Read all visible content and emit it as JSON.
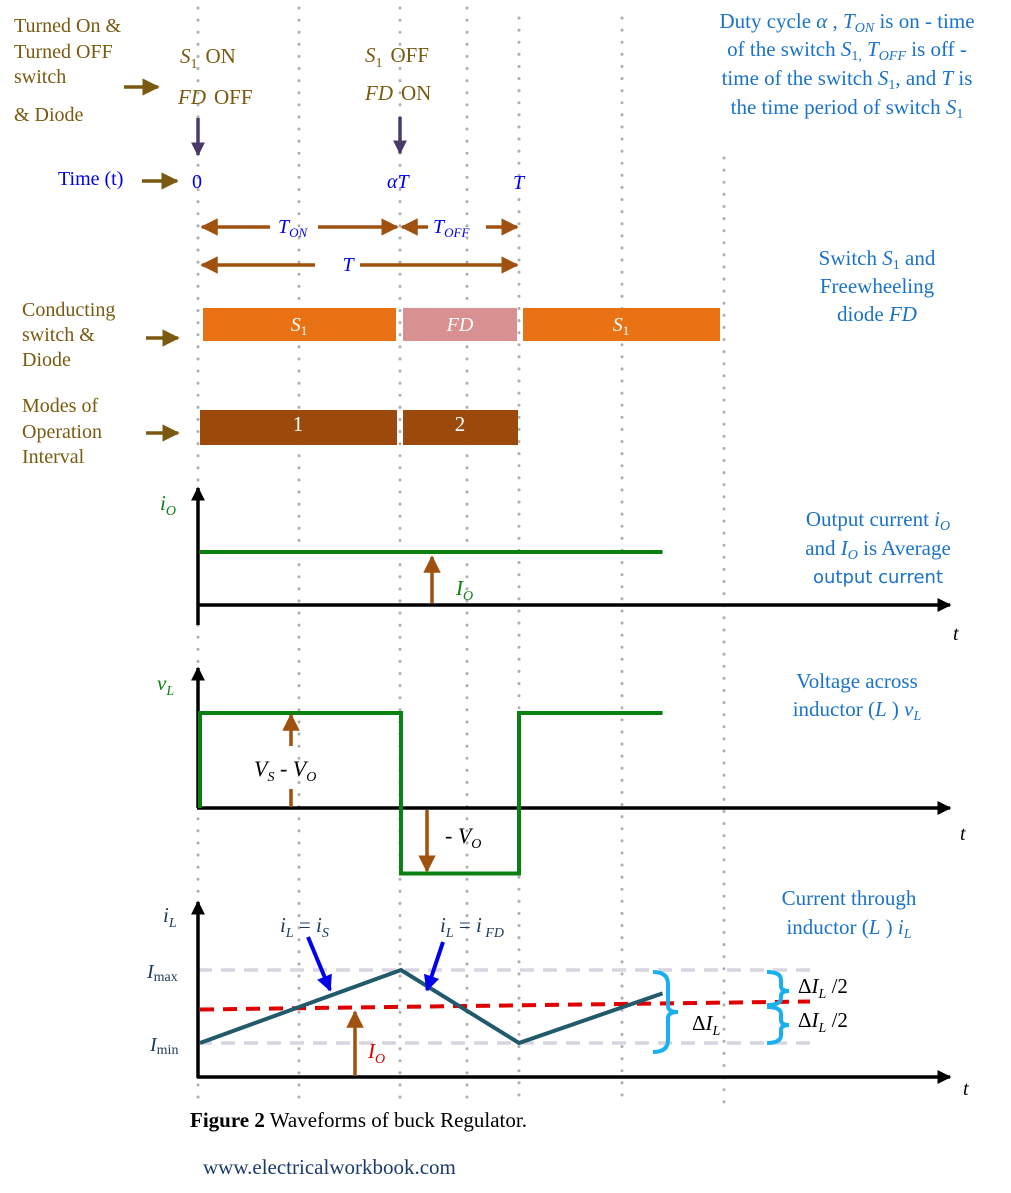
{
  "header": {
    "left_label_lines": [
      "Turned On &",
      "Turned OFF",
      "switch",
      "& Diode"
    ],
    "event_0": {
      "line1_sym": "S",
      "line1_sub": "1",
      "line1_state": "ON",
      "line2_sym": "FD",
      "line2_state": "OFF"
    },
    "event_aT": {
      "line1_sym": "S",
      "line1_sub": "1",
      "line1_state": "OFF",
      "line2_sym": "FD",
      "line2_state": "ON"
    },
    "time_label": "Time (t)",
    "time_ticks": [
      "0",
      "αT",
      "T"
    ]
  },
  "description": {
    "lines": [
      "Duty cycle α , T_ON is on - time",
      "of the switch S1, T_OFF is off -",
      "time of the switch S1, and T is",
      "the time period of switch S1"
    ]
  },
  "intervals": {
    "ton": "T",
    "ton_sub": "ON",
    "toff": "T",
    "toff_sub": "OFF",
    "period": "T"
  },
  "conducting": {
    "label_lines": [
      "Conducting",
      "switch &",
      "Diode"
    ],
    "segments": [
      {
        "label": "S",
        "sub": "1",
        "color": "#e87214"
      },
      {
        "label": "FD",
        "sub": "",
        "color": "#d89090"
      },
      {
        "label": "S",
        "sub": "1",
        "color": "#e87214"
      }
    ],
    "note_lines": [
      "Switch S1 and",
      "Freewheeling",
      "diode FD"
    ]
  },
  "modes": {
    "label_lines": [
      "Modes of",
      "Operation",
      "Interval"
    ],
    "segments": [
      {
        "label": "1",
        "color": "#9b4a0c"
      },
      {
        "label": "2",
        "color": "#9b4a0c"
      }
    ]
  },
  "chart_data": [
    {
      "type": "line",
      "title": "Output current",
      "ylabel": "iO",
      "xlabel": "t",
      "series": [
        {
          "name": "iO",
          "x": [
            0,
            1.45
          ],
          "y": [
            1,
            1
          ],
          "color": "#0a8010"
        }
      ],
      "annotations": [
        {
          "text": "IO",
          "meaning": "Average output current"
        }
      ],
      "note_lines": [
        "Output current iO",
        "and IO is Average",
        "output current"
      ]
    },
    {
      "type": "line",
      "title": "Voltage across inductor",
      "ylabel": "vL",
      "xlabel": "t",
      "alpha": 0.63,
      "series": [
        {
          "name": "vL",
          "x": [
            0,
            0,
            0.63,
            0.63,
            1.0,
            1.0,
            1.45
          ],
          "y": [
            0,
            1,
            1,
            -0.69,
            -0.69,
            1,
            1
          ],
          "color": "#0a8010"
        }
      ],
      "annotations": [
        {
          "text": "VS - VO",
          "level": "positive"
        },
        {
          "text": "- VO",
          "level": "negative"
        }
      ],
      "note_lines": [
        "Voltage across",
        "inductor (L) vL"
      ]
    },
    {
      "type": "line",
      "title": "Current through inductor",
      "ylabel": "iL",
      "xlabel": "t",
      "tick_labels": [
        "Imax",
        "Imin"
      ],
      "series": [
        {
          "name": "iL",
          "x": [
            0,
            0.63,
            1.0,
            1.45
          ],
          "y": [
            0,
            1,
            0,
            0.68
          ],
          "color": "#215a6a"
        },
        {
          "name": "IO (average)",
          "x": [
            0,
            1.9
          ],
          "y": [
            0.5,
            0.5
          ],
          "color": "#e00000",
          "style": "dashed"
        }
      ],
      "annotations": [
        {
          "text": "iL = iS",
          "segment": "rising"
        },
        {
          "text": "iL = iFD",
          "segment": "falling"
        },
        {
          "text": "IO",
          "meaning": "average"
        },
        {
          "text": "ΔIL",
          "meaning": "ripple"
        },
        {
          "text": "ΔIL/2",
          "meaning": "upper half ripple"
        },
        {
          "text": "ΔIL/2",
          "meaning": "lower half ripple"
        }
      ],
      "note_lines": [
        "Current through",
        "inductor (L) iL"
      ]
    }
  ],
  "footer": {
    "caption_bold": "Figure 2",
    "caption_text": " Waveforms of buck Regulator.",
    "website": "www.electricalworkbook.com"
  }
}
